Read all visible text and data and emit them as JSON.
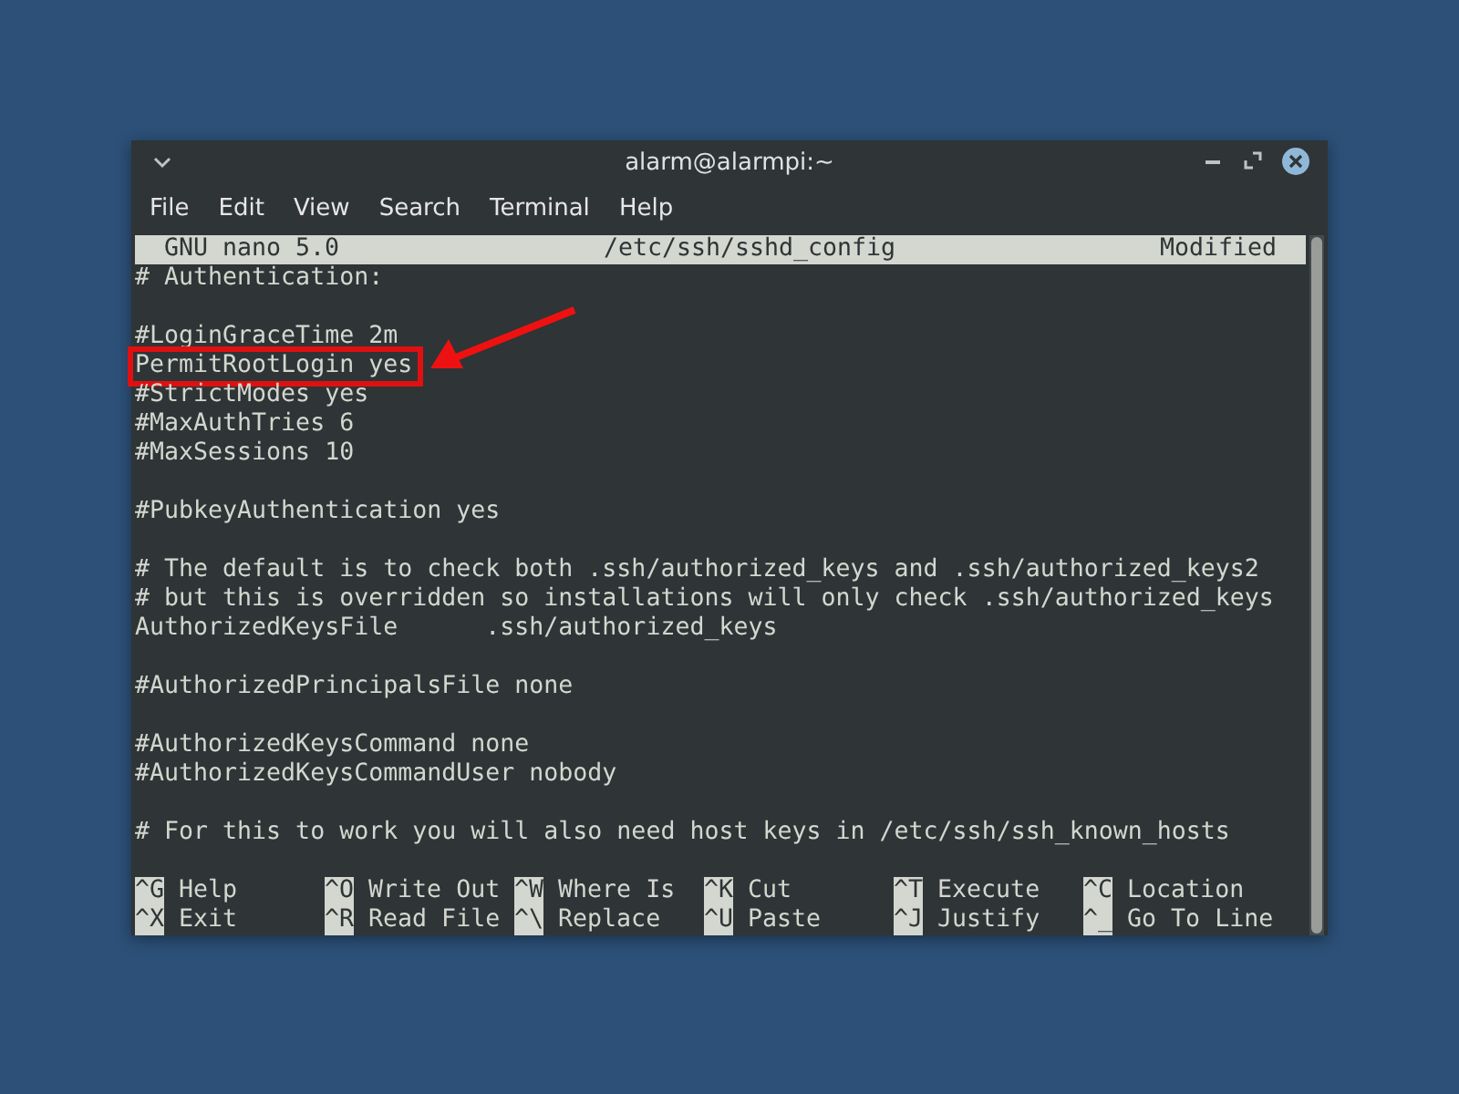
{
  "window": {
    "title": "alarm@alarmpi:~"
  },
  "menu": [
    "File",
    "Edit",
    "View",
    "Search",
    "Terminal",
    "Help"
  ],
  "nano_header": {
    "version": "GNU nano 5.0",
    "file": "/etc/ssh/sshd_config",
    "status": "Modified"
  },
  "lines": [
    {
      "kind": "text",
      "text": "# Authentication:",
      "highlighted": false
    },
    {
      "kind": "blank"
    },
    {
      "kind": "text",
      "text": "#LoginGraceTime 2m",
      "highlighted": false
    },
    {
      "kind": "text",
      "text": "PermitRootLogin yes",
      "highlighted": true
    },
    {
      "kind": "text",
      "text": "#StrictModes yes",
      "highlighted": false
    },
    {
      "kind": "text",
      "text": "#MaxAuthTries 6",
      "highlighted": false
    },
    {
      "kind": "text",
      "text": "#MaxSessions 10",
      "highlighted": false
    },
    {
      "kind": "blank"
    },
    {
      "kind": "text",
      "text": "#PubkeyAuthentication yes",
      "highlighted": false
    },
    {
      "kind": "blank"
    },
    {
      "kind": "text",
      "text": "# The default is to check both .ssh/authorized_keys and .ssh/authorized_keys2",
      "highlighted": false
    },
    {
      "kind": "text",
      "text": "# but this is overridden so installations will only check .ssh/authorized_keys",
      "highlighted": false
    },
    {
      "kind": "text",
      "text": "AuthorizedKeysFile      .ssh/authorized_keys",
      "highlighted": false
    },
    {
      "kind": "blank"
    },
    {
      "kind": "text",
      "text": "#AuthorizedPrincipalsFile none",
      "highlighted": false
    },
    {
      "kind": "blank"
    },
    {
      "kind": "text",
      "text": "#AuthorizedKeysCommand none",
      "highlighted": false
    },
    {
      "kind": "text",
      "text": "#AuthorizedKeysCommandUser nobody",
      "highlighted": false
    },
    {
      "kind": "blank"
    },
    {
      "kind": "text",
      "text": "# For this to work you will also need host keys in /etc/ssh/ssh_known_hosts",
      "highlighted": false
    }
  ],
  "shortcuts": [
    [
      {
        "key": "^G",
        "label": "Help"
      },
      {
        "key": "^X",
        "label": "Exit"
      }
    ],
    [
      {
        "key": "^O",
        "label": "Write Out"
      },
      {
        "key": "^R",
        "label": "Read File"
      }
    ],
    [
      {
        "key": "^W",
        "label": "Where Is"
      },
      {
        "key": "^\\",
        "label": "Replace"
      }
    ],
    [
      {
        "key": "^K",
        "label": "Cut"
      },
      {
        "key": "^U",
        "label": "Paste"
      }
    ],
    [
      {
        "key": "^T",
        "label": "Execute"
      },
      {
        "key": "^J",
        "label": "Justify"
      }
    ],
    [
      {
        "key": "^C",
        "label": "Location"
      },
      {
        "key": "^_",
        "label": "Go To Line"
      }
    ]
  ]
}
